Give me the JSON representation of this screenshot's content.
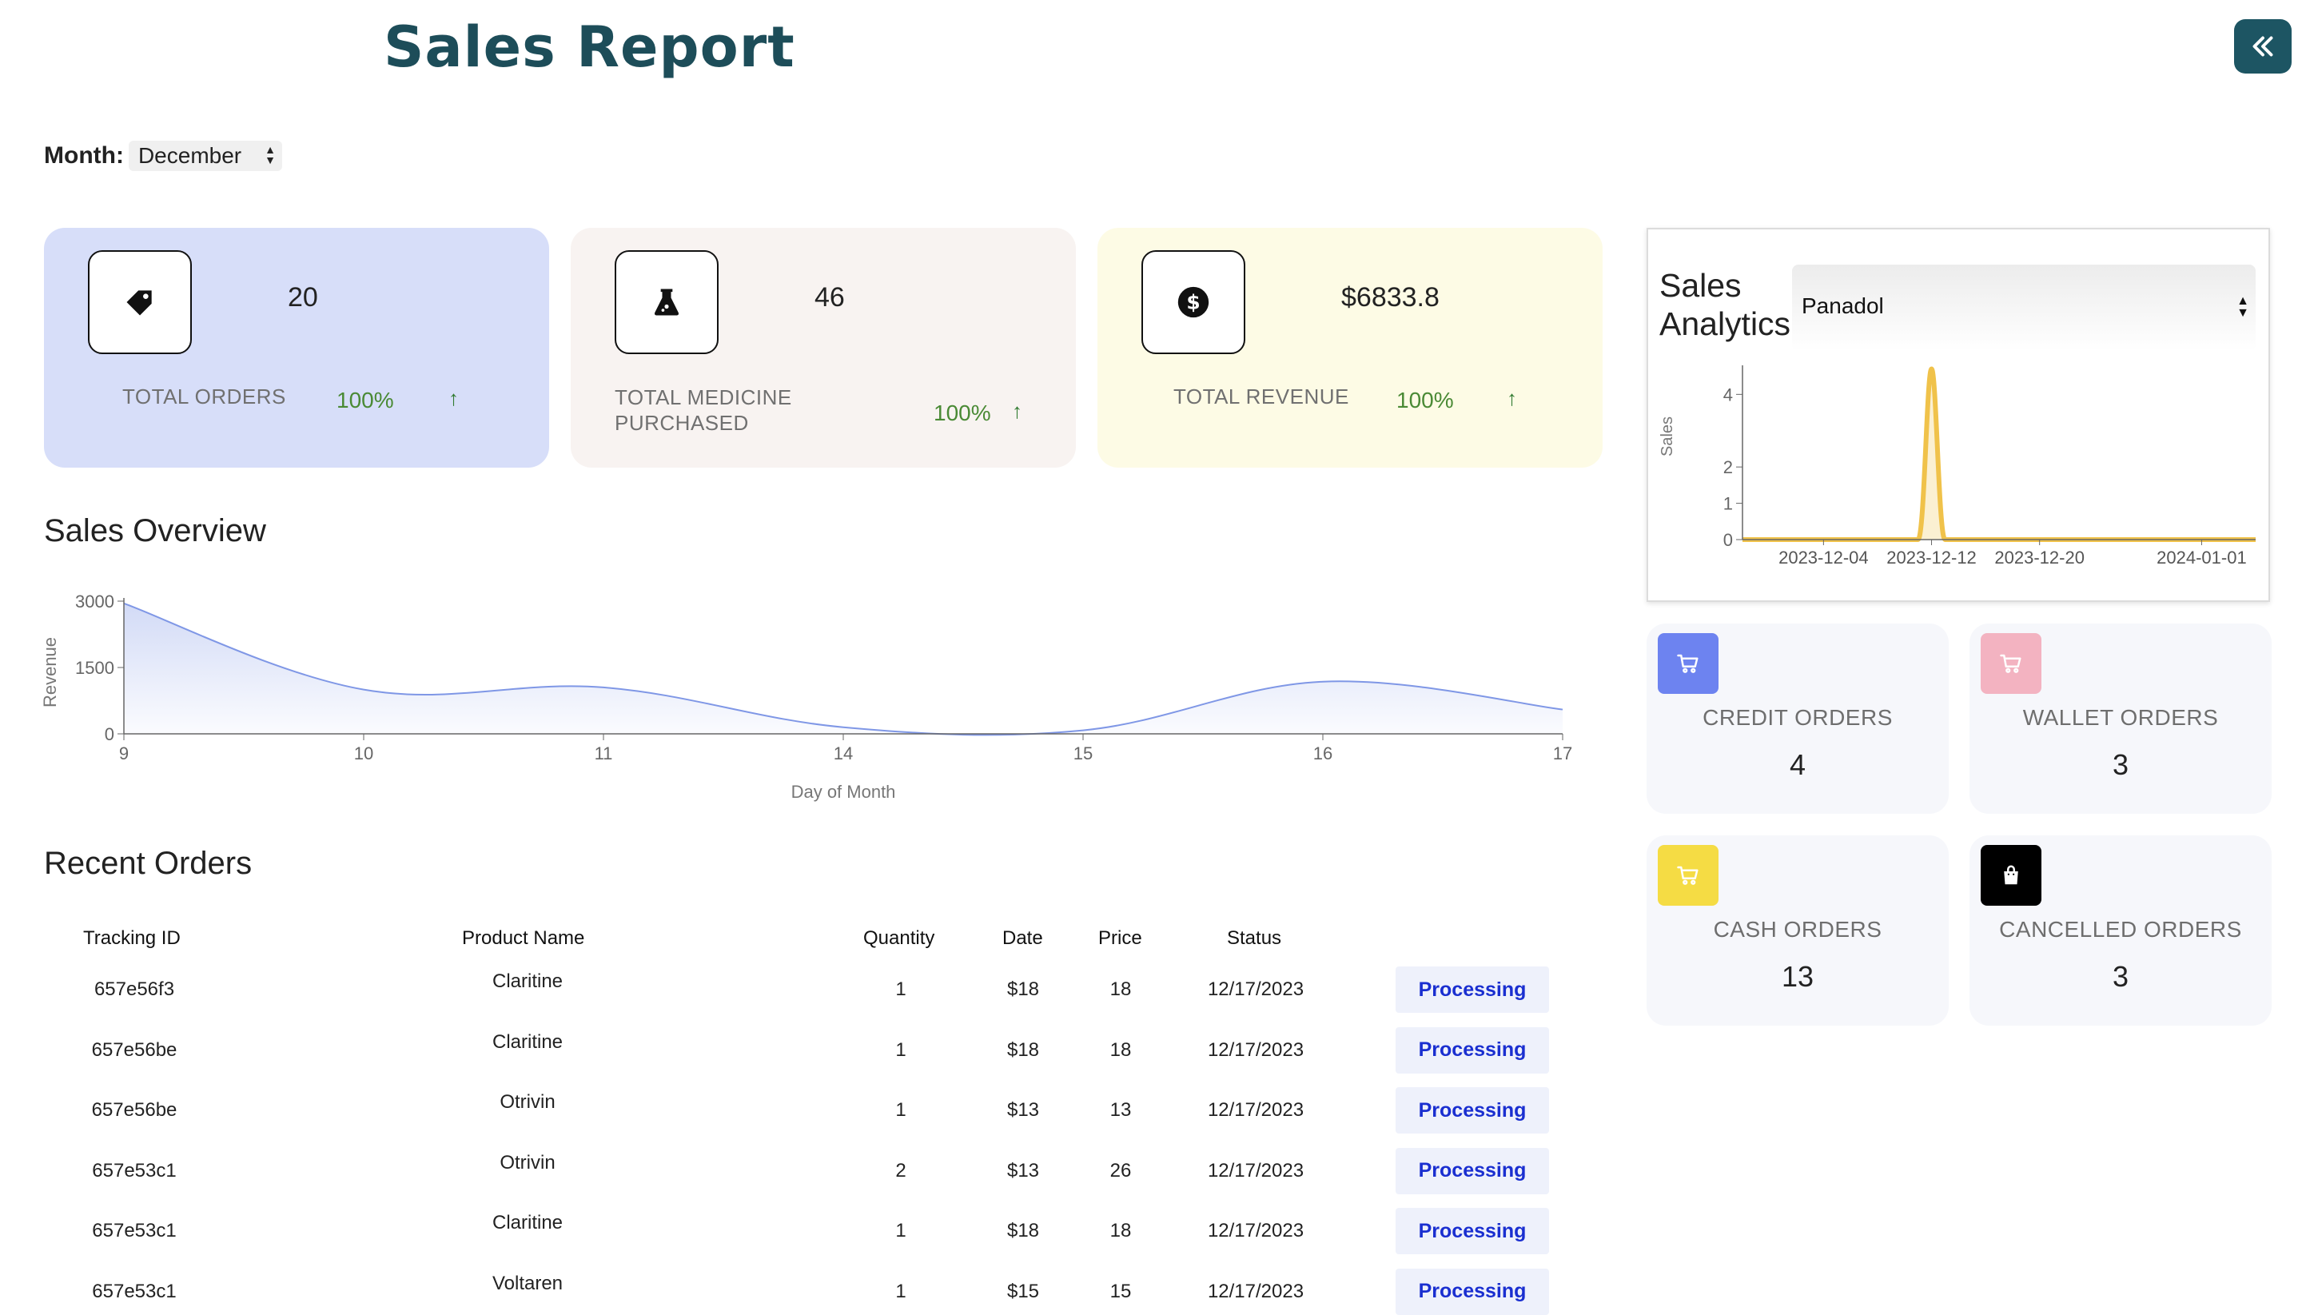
{
  "page": {
    "title": "Sales Report",
    "month_label": "Month:",
    "month_value": "December"
  },
  "stats": [
    {
      "value": "20",
      "label_lines": [
        "TOTAL ORDERS"
      ],
      "pct": "100%",
      "bg": "#d7def9",
      "icon": "tag-icon"
    },
    {
      "value": "46",
      "label_lines": [
        "TOTAL MEDICINE",
        "PURCHASED"
      ],
      "pct": "100%",
      "bg": "#f8f3f1",
      "icon": "flask-icon"
    },
    {
      "value": "$6833.8",
      "label_lines": [
        "TOTAL REVENUE"
      ],
      "pct": "100%",
      "bg": "#fdfbe5",
      "icon": "dollar-icon"
    }
  ],
  "sales_overview": {
    "title": "Sales Overview",
    "chart_data": {
      "type": "area",
      "x": [
        9,
        10,
        11,
        14,
        15,
        16,
        17
      ],
      "y": [
        2950,
        1000,
        1050,
        150,
        80,
        1180,
        550
      ],
      "xlabel": "Day of Month",
      "ylabel": "Revenue",
      "yticks": [
        0,
        1500,
        3000
      ],
      "ylim": [
        0,
        3000
      ],
      "color": "#7f97e6"
    }
  },
  "recent_orders": {
    "title": "Recent Orders",
    "columns": [
      "Tracking ID",
      "Product Name",
      "Quantity",
      "Date",
      "Price",
      "Status"
    ],
    "rows": [
      {
        "id": "657e56f3",
        "product": "Claritine",
        "qty": "1",
        "date": "$18",
        "price": "18",
        "status_date": "12/17/2023",
        "status": "Processing"
      },
      {
        "id": "657e56be",
        "product": "Claritine",
        "qty": "1",
        "date": "$18",
        "price": "18",
        "status_date": "12/17/2023",
        "status": "Processing"
      },
      {
        "id": "657e56be",
        "product": "Otrivin",
        "qty": "1",
        "date": "$13",
        "price": "13",
        "status_date": "12/17/2023",
        "status": "Processing"
      },
      {
        "id": "657e53c1",
        "product": "Otrivin",
        "qty": "2",
        "date": "$13",
        "price": "26",
        "status_date": "12/17/2023",
        "status": "Processing"
      },
      {
        "id": "657e53c1",
        "product": "Claritine",
        "qty": "1",
        "date": "$18",
        "price": "18",
        "status_date": "12/17/2023",
        "status": "Processing"
      },
      {
        "id": "657e53c1",
        "product": "Voltaren",
        "qty": "1",
        "date": "$15",
        "price": "15",
        "status_date": "12/17/2023",
        "status": "Processing"
      }
    ]
  },
  "analytics": {
    "title_line1": "Sales",
    "title_line2": "Analytics",
    "product": "Panadol",
    "chart_data": {
      "type": "area",
      "x": [
        "2023-11-28",
        "2023-12-10",
        "2023-12-11",
        "2023-12-12",
        "2023-12-13",
        "2023-12-14",
        "2024-01-05"
      ],
      "y": [
        0,
        0,
        0,
        4.7,
        0,
        0,
        0
      ],
      "xticks": [
        "2023-12-04",
        "2023-12-12",
        "2023-12-20",
        "2024-01-01"
      ],
      "yticks": [
        0,
        1,
        2,
        4
      ],
      "ylabel": "Sales",
      "color": "#f0c24a"
    }
  },
  "order_types": [
    {
      "label": "CREDIT ORDERS",
      "count": "4",
      "color": "#6d83f0",
      "icon": "cart-icon"
    },
    {
      "label": "WALLET ORDERS",
      "count": "3",
      "color": "#f3b3c1",
      "icon": "cart-icon"
    },
    {
      "label": "CASH ORDERS",
      "count": "13",
      "color": "#f5dc44",
      "icon": "cart-icon"
    },
    {
      "label": "CANCELLED ORDERS",
      "count": "3",
      "color": "#000000",
      "icon": "bag-icon"
    }
  ]
}
